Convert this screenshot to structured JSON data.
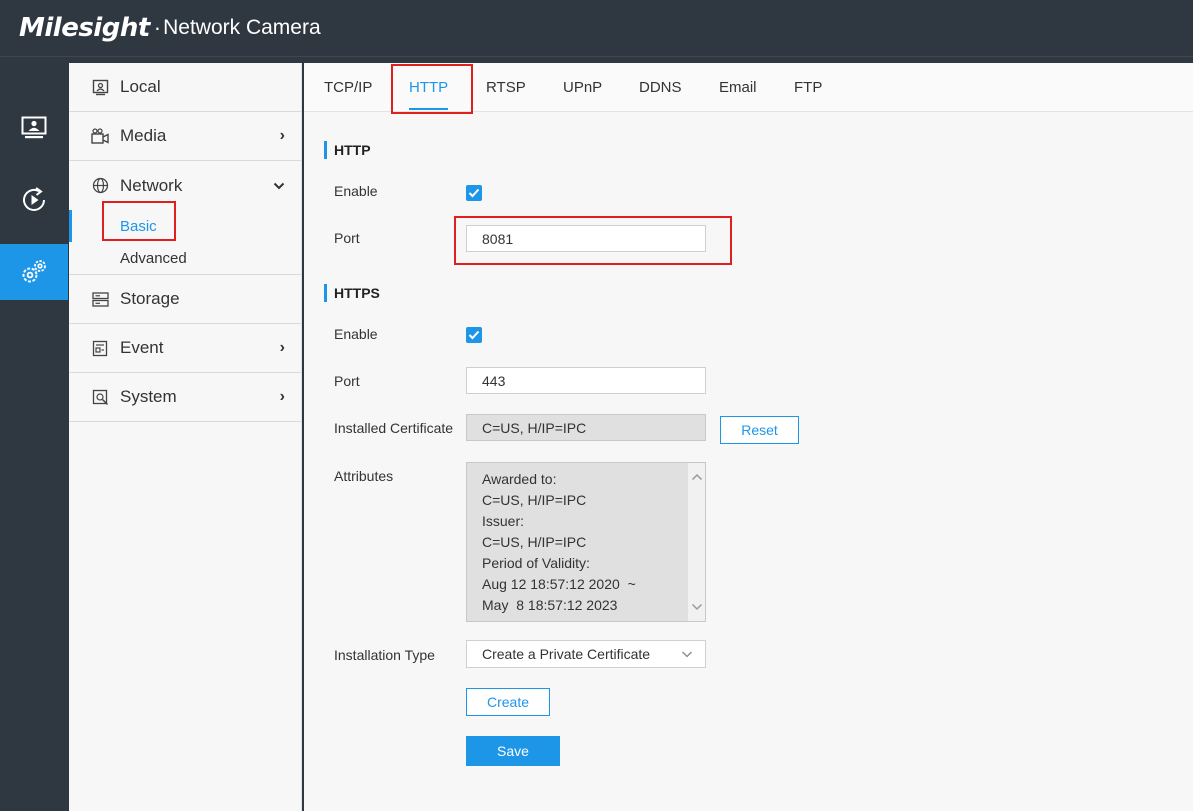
{
  "header": {
    "logo": "Milesight",
    "separator": "·",
    "product": "Network Camera"
  },
  "rail": {
    "items": [
      {
        "icon": "live-view-icon"
      },
      {
        "icon": "playback-icon"
      },
      {
        "icon": "settings-icon",
        "active": true
      }
    ]
  },
  "sidebar": {
    "local": "Local",
    "media": "Media",
    "network": "Network",
    "network_sub": {
      "basic": "Basic",
      "advanced": "Advanced"
    },
    "storage": "Storage",
    "event": "Event",
    "system": "System",
    "chevron_right": "›",
    "chevron_down": "⌄"
  },
  "tabs": [
    "TCP/IP",
    "HTTP",
    "RTSP",
    "UPnP",
    "DDNS",
    "Email",
    "FTP"
  ],
  "active_tab": "HTTP",
  "http": {
    "title": "HTTP",
    "enable_label": "Enable",
    "enable_checked": true,
    "port_label": "Port",
    "port_value": "8081"
  },
  "https": {
    "title": "HTTPS",
    "enable_label": "Enable",
    "enable_checked": true,
    "port_label": "Port",
    "port_value": "443",
    "cert_label": "Installed Certificate",
    "cert_value": "C=US, H/IP=IPC",
    "reset_label": "Reset",
    "attributes_label": "Attributes",
    "attributes_lines": [
      "Awarded to:",
      "C=US, H/IP=IPC",
      "Issuer:",
      "C=US, H/IP=IPC",
      "Period of Validity:",
      "Aug 12 18:57:12 2020  ~",
      "May  8 18:57:12 2023"
    ],
    "install_type_label": "Installation Type",
    "install_type_value": "Create a Private Certificate",
    "create_label": "Create",
    "save_label": "Save"
  },
  "colors": {
    "accent": "#1e96e8",
    "highlight": "#e02020",
    "chrome": "#2f3741"
  }
}
